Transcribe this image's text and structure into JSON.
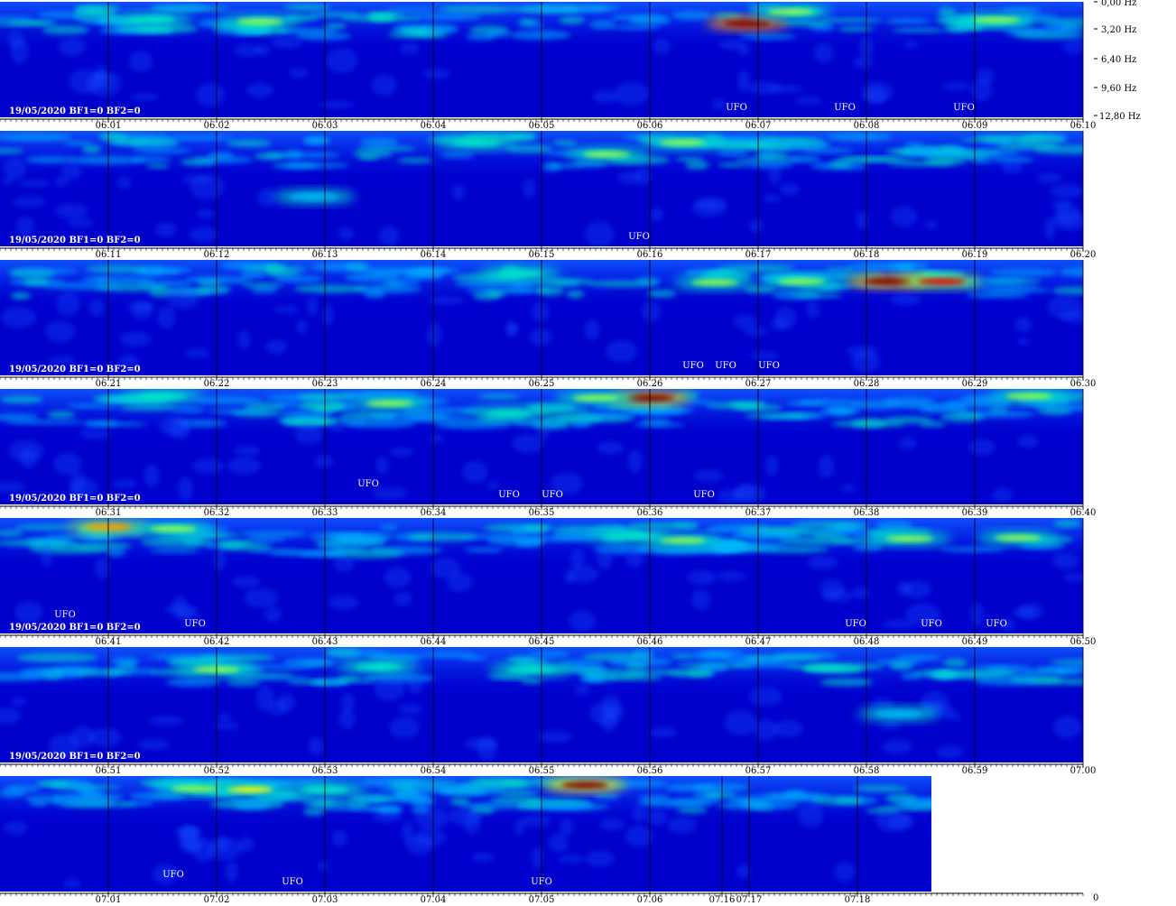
{
  "chart_data": {
    "type": "heatmap",
    "title": "",
    "xlabel": "",
    "ylabel": "",
    "colorscale": [
      "#0000c8",
      "#0a2cf0",
      "#1e64ff",
      "#00b4ff",
      "#00e6c8",
      "#8cff50",
      "#ffff00",
      "#ff9600",
      "#e60000",
      "#7a0000"
    ],
    "frequency_axis": {
      "ticks": [
        "0,00 Hz",
        "3,20 Hz",
        "6,40 Hz",
        "9,60 Hz",
        "12,80 Hz"
      ],
      "range": [
        0,
        12.8
      ]
    },
    "bottom_corner_label": "0",
    "rows": [
      {
        "date_label": "19/05/2020 BF1=0 BF2=0",
        "time_ticks": [
          "06.01",
          "06.02",
          "06.03",
          "06.04",
          "06.05",
          "06.06",
          "06.07",
          "06.08",
          "06.09",
          "06.10"
        ],
        "ufo_markers": [
          {
            "label": "UFO",
            "time": "06.06.8"
          },
          {
            "label": "UFO",
            "time": "06.07.8"
          },
          {
            "label": "UFO",
            "time": "06.08.9"
          }
        ],
        "hotspots": [
          {
            "time": "06.06.9",
            "freq": 2.4,
            "intensity": 1.0
          },
          {
            "time": "06.07.3",
            "freq": 1.1,
            "intensity": 0.55
          },
          {
            "time": "06.02.4",
            "freq": 2.2,
            "intensity": 0.6
          },
          {
            "time": "06.09.2",
            "freq": 2.0,
            "intensity": 0.55
          },
          {
            "time": "06.01.4",
            "freq": 2.0,
            "intensity": 0.45
          }
        ]
      },
      {
        "date_label": "19/05/2020 BF1=0 BF2=0",
        "time_ticks": [
          "06.11",
          "06.12",
          "06.13",
          "06.14",
          "06.15",
          "06.16",
          "06.17",
          "06.18",
          "06.19",
          "06.20"
        ],
        "ufo_markers": [
          {
            "label": "UFO",
            "time": "06.15.9"
          }
        ],
        "hotspots": [
          {
            "time": "06.16.3",
            "freq": 1.3,
            "intensity": 0.5
          },
          {
            "time": "06.15.6",
            "freq": 2.6,
            "intensity": 0.5
          },
          {
            "time": "06.14.4",
            "freq": 1.3,
            "intensity": 0.45
          },
          {
            "time": "06.12.9",
            "freq": 7.3,
            "intensity": 0.35
          }
        ]
      },
      {
        "date_label": "19/05/2020 BF1=0 BF2=0",
        "time_ticks": [
          "06.21",
          "06.22",
          "06.23",
          "06.24",
          "06.25",
          "06.26",
          "06.27",
          "06.28",
          "06.29",
          "06.30"
        ],
        "ufo_markers": [
          {
            "label": "UFO",
            "time": "06.26.4"
          },
          {
            "label": "UFO",
            "time": "06.26.7"
          },
          {
            "label": "UFO",
            "time": "06.27.1"
          }
        ],
        "hotspots": [
          {
            "time": "06.28.2",
            "freq": 2.4,
            "intensity": 1.0
          },
          {
            "time": "06.28.7",
            "freq": 2.4,
            "intensity": 0.85
          },
          {
            "time": "06.27.4",
            "freq": 2.4,
            "intensity": 0.6
          },
          {
            "time": "06.26.6",
            "freq": 2.5,
            "intensity": 0.5
          },
          {
            "time": "06.24.8",
            "freq": 1.5,
            "intensity": 0.45
          }
        ]
      },
      {
        "date_label": "19/05/2020 BF1=0 BF2=0",
        "time_ticks": [
          "06.31",
          "06.32",
          "06.33",
          "06.34",
          "06.35",
          "06.36",
          "06.37",
          "06.38",
          "06.39",
          "06.40"
        ],
        "ufo_markers": [
          {
            "label": "UFO",
            "time": "06.33.4"
          },
          {
            "label": "UFO",
            "time": "06.34.7"
          },
          {
            "label": "UFO",
            "time": "06.35.1"
          },
          {
            "label": "UFO",
            "time": "06.36.5"
          }
        ],
        "hotspots": [
          {
            "time": "06.36.0",
            "freq": 1.0,
            "intensity": 1.0
          },
          {
            "time": "06.35.5",
            "freq": 1.0,
            "intensity": 0.6
          },
          {
            "time": "06.33.6",
            "freq": 1.6,
            "intensity": 0.55
          },
          {
            "time": "06.39.5",
            "freq": 0.8,
            "intensity": 0.5
          },
          {
            "time": "06.31.5",
            "freq": 0.8,
            "intensity": 0.45
          },
          {
            "time": "06.34.7",
            "freq": 2.7,
            "intensity": 0.45
          }
        ]
      },
      {
        "date_label": "19/05/2020 BF1=0 BF2=0",
        "time_ticks": [
          "06.41",
          "06.42",
          "06.43",
          "06.44",
          "06.45",
          "06.46",
          "06.47",
          "06.48",
          "06.49",
          "06.50"
        ],
        "ufo_markers": [
          {
            "label": "UFO",
            "time": "06.40.6"
          },
          {
            "label": "UFO",
            "time": "06.41.8"
          },
          {
            "label": "UFO",
            "time": "06.47.9"
          },
          {
            "label": "UFO",
            "time": "06.48.6"
          },
          {
            "label": "UFO",
            "time": "06.49.2"
          }
        ],
        "hotspots": [
          {
            "time": "06.41.0",
            "freq": 1.0,
            "intensity": 0.75
          },
          {
            "time": "06.41.6",
            "freq": 1.2,
            "intensity": 0.55
          },
          {
            "time": "06.46.3",
            "freq": 2.5,
            "intensity": 0.55
          },
          {
            "time": "06.48.4",
            "freq": 2.3,
            "intensity": 0.6
          },
          {
            "time": "06.49.4",
            "freq": 2.2,
            "intensity": 0.55
          },
          {
            "time": "06.45.8",
            "freq": 2.0,
            "intensity": 0.45
          }
        ]
      },
      {
        "date_label": "19/05/2020 BF1=0 BF2=0",
        "time_ticks": [
          "06.51",
          "06.52",
          "06.53",
          "06.54",
          "06.55",
          "06.56",
          "06.57",
          "06.58",
          "06.59",
          "07.00"
        ],
        "ufo_markers": [],
        "hotspots": [
          {
            "time": "06.52.0",
            "freq": 2.5,
            "intensity": 0.55
          },
          {
            "time": "06.54.9",
            "freq": 2.5,
            "intensity": 0.45
          },
          {
            "time": "06.53.5",
            "freq": 2.2,
            "intensity": 0.45
          },
          {
            "time": "06.58.3",
            "freq": 7.4,
            "intensity": 0.35
          }
        ]
      },
      {
        "date_label": "",
        "time_ticks": [
          "07.01",
          "07.02",
          "07.03",
          "07.04",
          "07.05",
          "07.06",
          "07.16",
          "07.17",
          "07.18"
        ],
        "ufo_markers": [
          {
            "label": "UFO",
            "time": "07.01.6"
          },
          {
            "label": "UFO",
            "time": "07.02.7"
          },
          {
            "label": "UFO",
            "time": "07.05.0"
          }
        ],
        "hotspots": [
          {
            "time": "07.05.4",
            "freq": 1.0,
            "intensity": 0.95
          },
          {
            "time": "07.02.3",
            "freq": 1.5,
            "intensity": 0.7
          },
          {
            "time": "07.01.8",
            "freq": 1.4,
            "intensity": 0.55
          },
          {
            "time": "07.03.0",
            "freq": 1.5,
            "intensity": 0.45
          },
          {
            "time": "07.16.9",
            "freq": 1.0,
            "intensity": 0.45
          }
        ]
      }
    ]
  }
}
